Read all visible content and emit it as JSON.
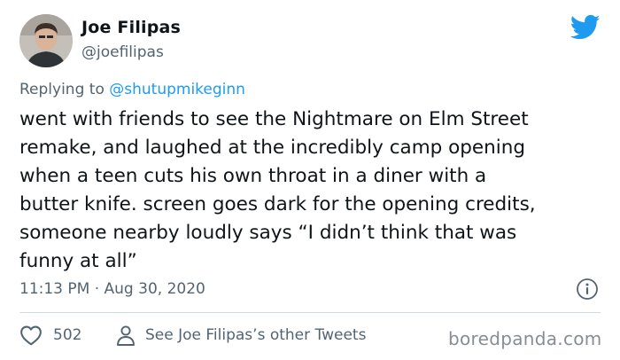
{
  "author": {
    "name": "Joe Filipas",
    "handle": "@joefilipas"
  },
  "reply": {
    "prefix": "Replying to ",
    "mention": "@shutupmikeginn"
  },
  "tweet": {
    "text": "went with friends to see the Nightmare on Elm Street\nremake, and laughed at the incredibly camp opening\nwhen a teen cuts his own throat in a diner with a\nbutter knife. screen goes dark for the opening credits,\nsomeone nearby loudly says “I didn’t think that was\nfunny at all”",
    "timestamp": "11:13 PM · Aug 30, 2020"
  },
  "actions": {
    "like_count": "502",
    "other_tweets_label": "See Joe Filipas’s other Tweets"
  },
  "watermark": "boredpanda.com",
  "colors": {
    "brand_blue": "#1d9bf0",
    "text_primary": "#0f1419",
    "text_secondary": "#536471",
    "divider": "#cfd9de"
  },
  "icons": {
    "brand": "twitter-bird-icon",
    "info": "info-icon",
    "like": "heart-icon",
    "profile": "person-icon"
  }
}
